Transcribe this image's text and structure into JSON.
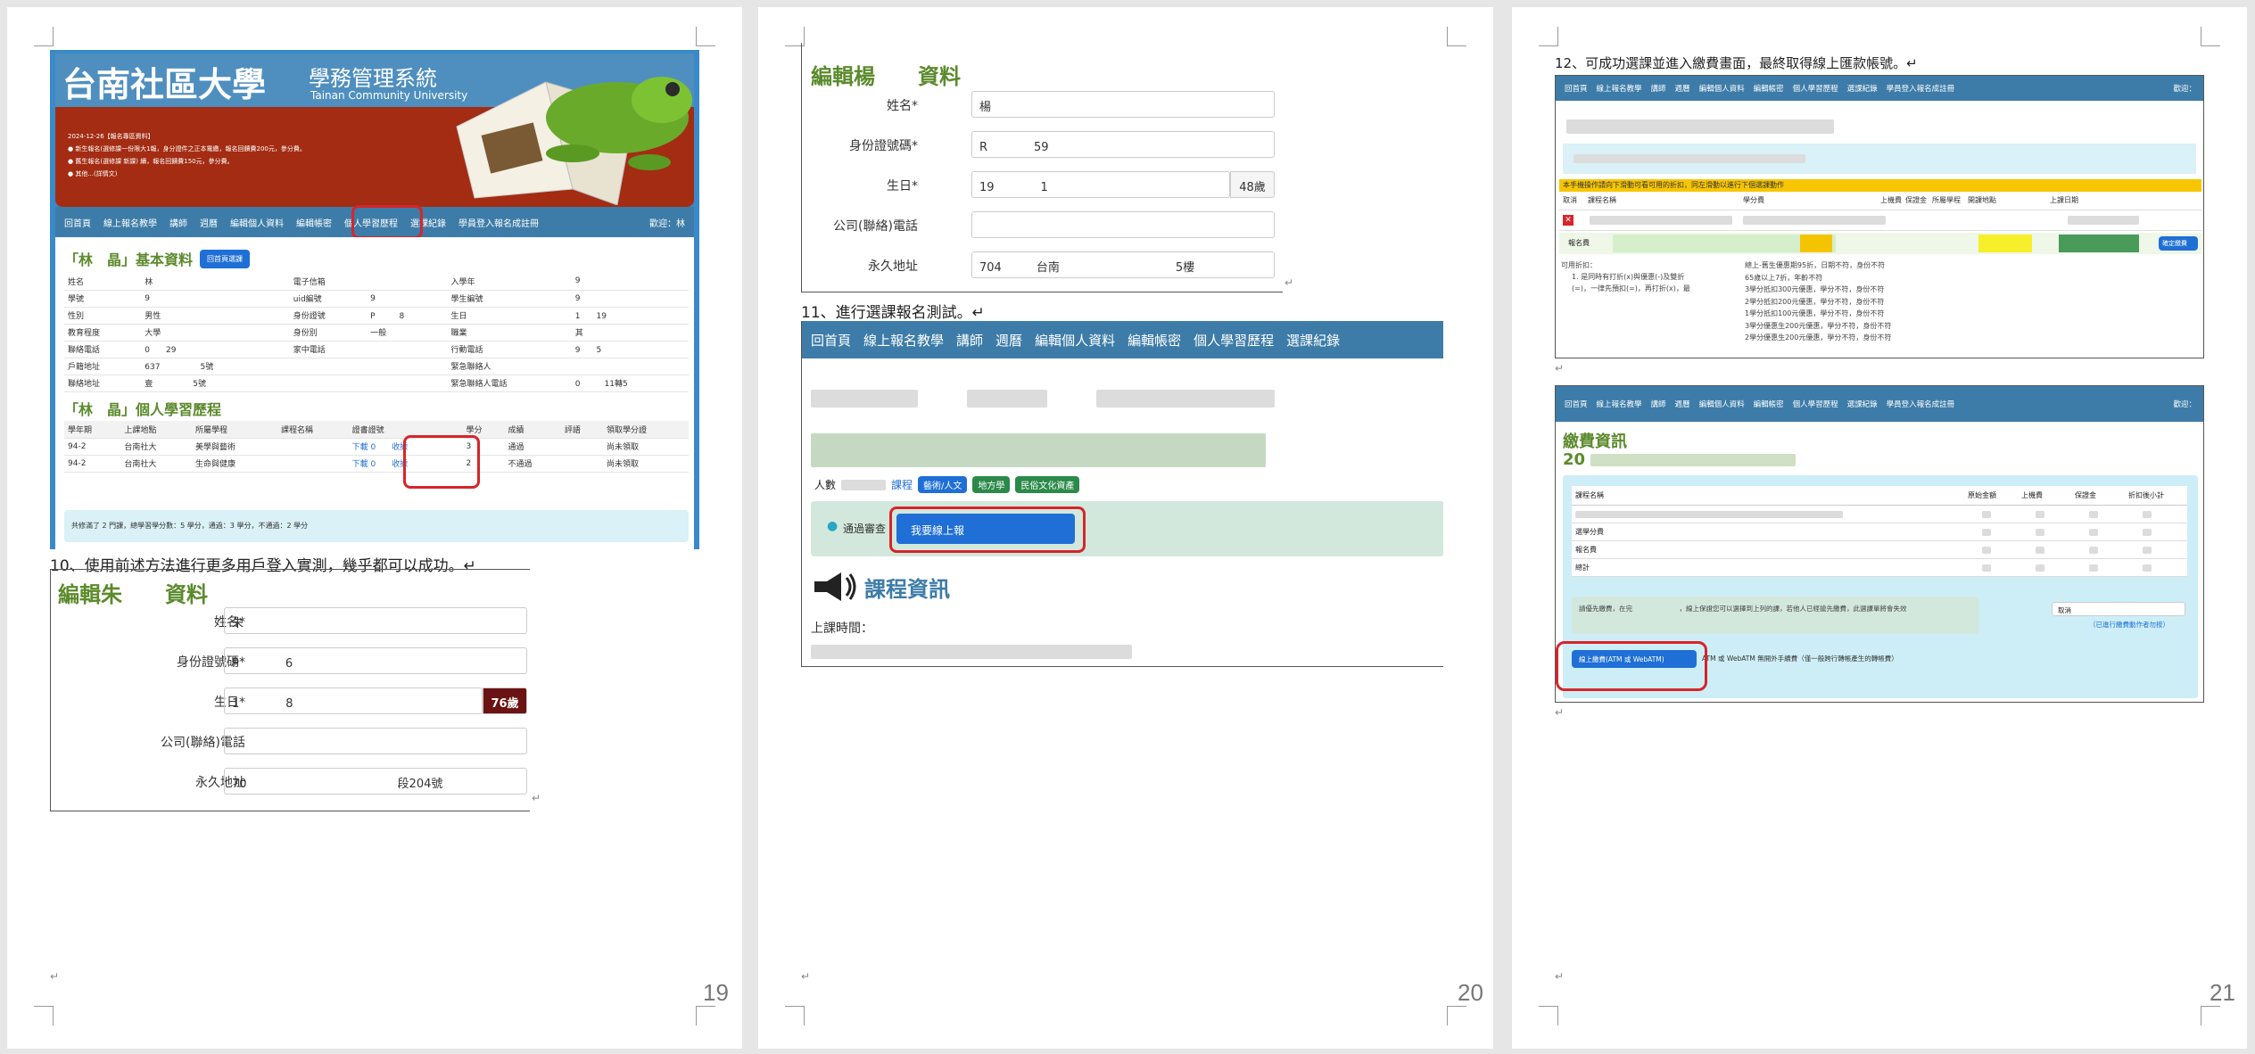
{
  "pages": [
    {
      "page_number": "19",
      "header": {
        "title": "台南社區大學",
        "subtitle": "學務管理系統",
        "subtitle_en": "Tainan Community University"
      },
      "notices": [
        "2024-12-26【報名專區資料】",
        "● 新生報名(選修課一份限大1報，身分證件之正本電繳，報名回饋費200元，參分費。",
        "● 舊生報名(選修課 新課) 續，報名回饋費150元，參分費。",
        "● 其他...(詳情文)"
      ],
      "nav": [
        "回首頁",
        "線上報名教學",
        "講師",
        "週曆",
        "編輯個人資料",
        "編輯帳密",
        "個人學習歷程",
        "選課紀錄",
        "學員登入報名成註冊"
      ],
      "nav_right": "歡迎：林",
      "basic_title": "「林　晶」基本資料",
      "basic_button": "回首頁選課",
      "basic_rows": [
        [
          "姓名",
          "林",
          "電子信箱",
          "",
          "入學年",
          "9"
        ],
        [
          "學號",
          "9",
          "uid編號",
          "9",
          "學生編號",
          "9"
        ],
        [
          "性別",
          "男性",
          "身份證號",
          "P　　　8",
          "生日",
          "1　　19"
        ],
        [
          "教育程度",
          "大學",
          "身份別",
          "一般",
          "職業",
          "其"
        ],
        [
          "聯絡電話",
          "0　　29",
          "家中電話",
          "",
          "行動電話",
          "9　　5"
        ],
        [
          "戶籍地址",
          "637　　　　　5號",
          "",
          "",
          "緊急聯絡人",
          ""
        ],
        [
          "聯絡地址",
          "壹　　　　　5號",
          "",
          "",
          "緊急聯絡人電話",
          "0　　　11轉5"
        ]
      ],
      "history_title": "「林　晶」個人學習歷程",
      "history_headers": [
        "學年期",
        "上課地點",
        "所屬學程",
        "課程名稱",
        "證書證號",
        "學分",
        "成績",
        "評語",
        "領取學分證"
      ],
      "history_rows": [
        [
          "94-2",
          "台南社大",
          "美學與藝術",
          "",
          "下載 0　　收據",
          "3",
          "通過",
          "",
          "尚未領取"
        ],
        [
          "94-2",
          "台南社大",
          "生命與健康",
          "",
          "下載 0　　收據",
          "2",
          "不通過",
          "",
          "尚未領取"
        ]
      ],
      "summary": "共修滿了 2 門課，總學習學分數：5 學分，通過：3 學分，不通過：2 學分",
      "caption10": "10、使用前述方法進行更多用戶登入實測，幾乎都可以成功。↵",
      "edit_title": "編輯朱　　資料",
      "edit_fields": [
        {
          "label": "姓名*",
          "value": "朱"
        },
        {
          "label": "身份證號碼*",
          "value": "P　　　　6"
        },
        {
          "label": "生日*",
          "value": "1　　　　8",
          "age": "76歲"
        },
        {
          "label": "公司(聯絡)電話",
          "value": ""
        },
        {
          "label": "永久地址",
          "value": "70　　　　　　　　　　　　　段204號"
        }
      ]
    },
    {
      "page_number": "20",
      "edit_title": "編輯楊　　資料",
      "edit_fields": [
        {
          "label": "姓名*",
          "value": "楊"
        },
        {
          "label": "身份證號碼*",
          "value": "R　　　　59"
        },
        {
          "label": "生日*",
          "value": "19　　　　1",
          "age": "48歲"
        },
        {
          "label": "公司(聯絡)電話",
          "value": ""
        },
        {
          "label": "永久地址",
          "value": "704　　　台南　　　　　　　　　　5樓"
        }
      ],
      "caption11": "11、進行選課報名測試。↵",
      "nav": [
        "回首頁",
        "線上報名教學",
        "講師",
        "週曆",
        "編輯個人資料",
        "編輯帳密",
        "個人學習歷程",
        "選課紀錄"
      ],
      "tags_prefix": "人數",
      "tags_label": "課程",
      "tags": [
        "藝術/人文",
        "地方學",
        "民俗文化資產"
      ],
      "notice_prefix": "通過審查",
      "enroll_button": "我要線上報",
      "course_info_title": "課程資訊",
      "class_time_label": "上課時間："
    },
    {
      "page_number": "21",
      "caption12": "12、可成功選課並進入繳費畫面，最終取得線上匯款帳號。↵",
      "nav": [
        "回首頁",
        "線上報名教學",
        "講師",
        "週曆",
        "編輯個人資料",
        "編輯帳密",
        "個人學習歷程",
        "選課紀錄",
        "學員登入報名成註冊"
      ],
      "nav_right": "歡迎：",
      "warning": "本手機操作請向下滑動可看可用的折扣，同左滑動以進行下個選課動作",
      "cart_headers": [
        "取消",
        "課程名稱",
        "學分費",
        "上機費",
        "保證金",
        "所屬學程",
        "開課地點",
        "上課日期"
      ],
      "cart_row_label": "報名費",
      "confirm_button": "確定繳費",
      "discount_title": "可用折扣：",
      "discount_text": [
        "1. 是同時有打折(x)與優惠(-)及雙折",
        "(=)，一律先預扣(=)，再打折(x)，最"
      ],
      "discount_list": [
        "總上-舊生優惠期95折，日期不符，身份不符",
        "65歲以上7折，年齡不符",
        "3學分抵扣300元優惠，學分不符，身份不符",
        "2學分抵扣200元優惠，學分不符，身份不符",
        "1學分抵扣100元優惠，學分不符，身份不符",
        "3學分優惠生200元優惠，學分不符，身份不符",
        "2學分優惠生200元優惠，學分不符，身份不符"
      ],
      "payment_title": "繳費資訊",
      "payment_sub": "20",
      "payment_headers": [
        "課程名稱",
        "原始金額",
        "上機費",
        "保證金",
        "折扣後小計"
      ],
      "payment_rows": [
        "",
        "選學分費",
        "報名費",
        "總計"
      ],
      "payment_note": "請優先繳費，在完　　　　　　　，線上保證您可以選擇到上列的課，若他人已經搶先繳費，此選課單將會失效",
      "cancel_text": "取消",
      "cancel_note": "（已進行繳費動作者勿按）",
      "pay_button": "線上繳費(ATM 或 WebATM)",
      "pay_note": "ATM 或 WebATM 無開外手續費（僅一般跨行轉帳產生的轉帳費）"
    }
  ],
  "colors": {
    "nav": "#3d7ca8",
    "header_red": "#a32c12",
    "highlight_red": "#d6252b",
    "green_title": "#5b8a2c",
    "button_blue": "#1f6fd6"
  }
}
